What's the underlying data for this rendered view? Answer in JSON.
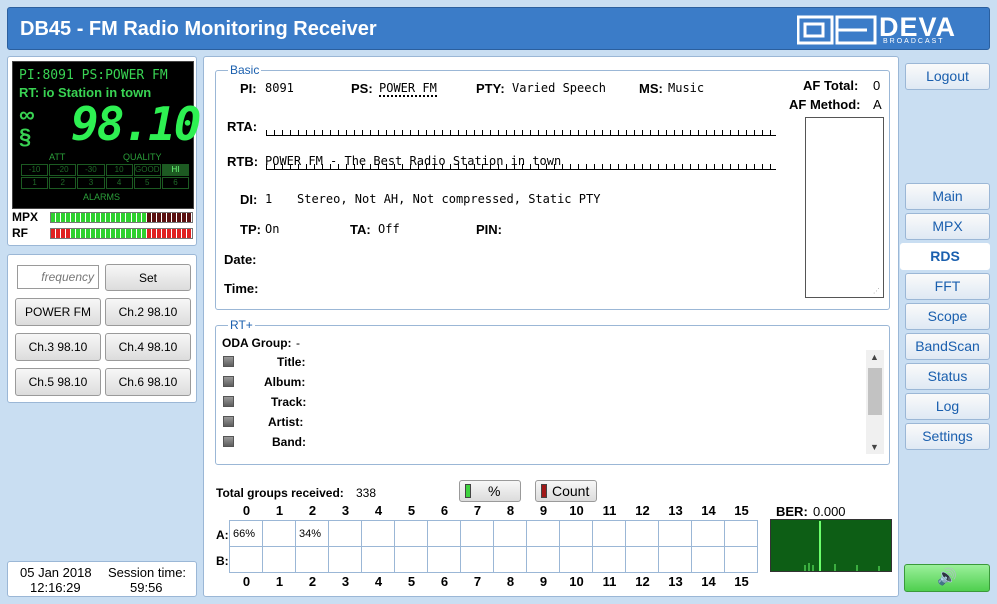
{
  "app": {
    "title": "DB45 - FM Radio Monitoring Receiver",
    "logo_text": "DEVA",
    "logo_sub": "BROADCAST"
  },
  "display": {
    "line1": "PI:8091 PS:POWER FM",
    "line2": "RT: io Station in town",
    "freq": "98.10",
    "att_label": "ATT",
    "quality_label": "QUALITY",
    "alarms_label": "ALARMS",
    "att_cells": [
      "-10",
      "-20",
      "-30"
    ],
    "quality_cells": [
      "10",
      "GOOD",
      "HI"
    ],
    "alarm_cells": [
      "1",
      "2",
      "3",
      "4",
      "5",
      "6"
    ],
    "mpx_label": "MPX",
    "rf_label": "RF",
    "mpx_level": 0.65,
    "rf_level": 0.2
  },
  "presets": {
    "freq_placeholder": "frequency",
    "set_label": "Set",
    "channels": [
      "POWER FM",
      "Ch.2 98.10",
      "Ch.3 98.10",
      "Ch.4 98.10",
      "Ch.5 98.10",
      "Ch.6 98.10"
    ]
  },
  "footer": {
    "date": "05 Jan 2018",
    "time": "12:16:29",
    "session_label": "Session time:",
    "session_value": "59:56"
  },
  "nav": {
    "logout": "Logout",
    "items": [
      "Main",
      "MPX",
      "RDS",
      "FFT",
      "Scope",
      "BandScan",
      "Status",
      "Log",
      "Settings"
    ],
    "active": "RDS"
  },
  "basic": {
    "legend": "Basic",
    "pi_label": "PI:",
    "pi": "8091",
    "ps_label": "PS:",
    "ps": "POWER FM",
    "pty_label": "PTY:",
    "pty": "Varied Speech",
    "ms_label": "MS:",
    "ms": "Music",
    "af_total_label": "AF Total:",
    "af_total": "0",
    "af_method_label": "AF Method:",
    "af_method": "A",
    "rta_label": "RTA:",
    "rtb_label": "RTB:",
    "rtb": "POWER FM - The Best Radio Station in town",
    "di_label": "DI:",
    "di": "1",
    "di_text": "Stereo, Not AH, Not compressed, Static PTY",
    "tp_label": "TP:",
    "tp": "On",
    "ta_label": "TA:",
    "ta": "Off",
    "pin_label": "PIN:",
    "date_label": "Date:",
    "time_label": "Time:"
  },
  "rtplus": {
    "legend": "RT+",
    "oda_label": "ODA Group:",
    "oda": "-",
    "fields": [
      "Title:",
      "Album:",
      "Track:",
      "Artist:",
      "Band:"
    ]
  },
  "groups": {
    "total_label": "Total groups received:",
    "total": "338",
    "pct_btn": "%",
    "count_btn": "Count",
    "cols": [
      "0",
      "1",
      "2",
      "3",
      "4",
      "5",
      "6",
      "7",
      "8",
      "9",
      "10",
      "11",
      "12",
      "13",
      "14",
      "15"
    ],
    "row_a_label": "A:",
    "row_b_label": "B:",
    "row_a": [
      "66%",
      "",
      "34%",
      "",
      "",
      "",
      "",
      "",
      "",
      "",
      "",
      "",
      "",
      "",
      "",
      ""
    ],
    "row_b": [
      "",
      "",
      "",
      "",
      "",
      "",
      "",
      "",
      "",
      "",
      "",
      "",
      "",
      "",
      "",
      ""
    ],
    "ber_label": "BER:",
    "ber": "0.000"
  },
  "colors": {
    "header": "#3b7cc8",
    "lcd": "#39d353",
    "panel_bg": "#c9def2"
  }
}
